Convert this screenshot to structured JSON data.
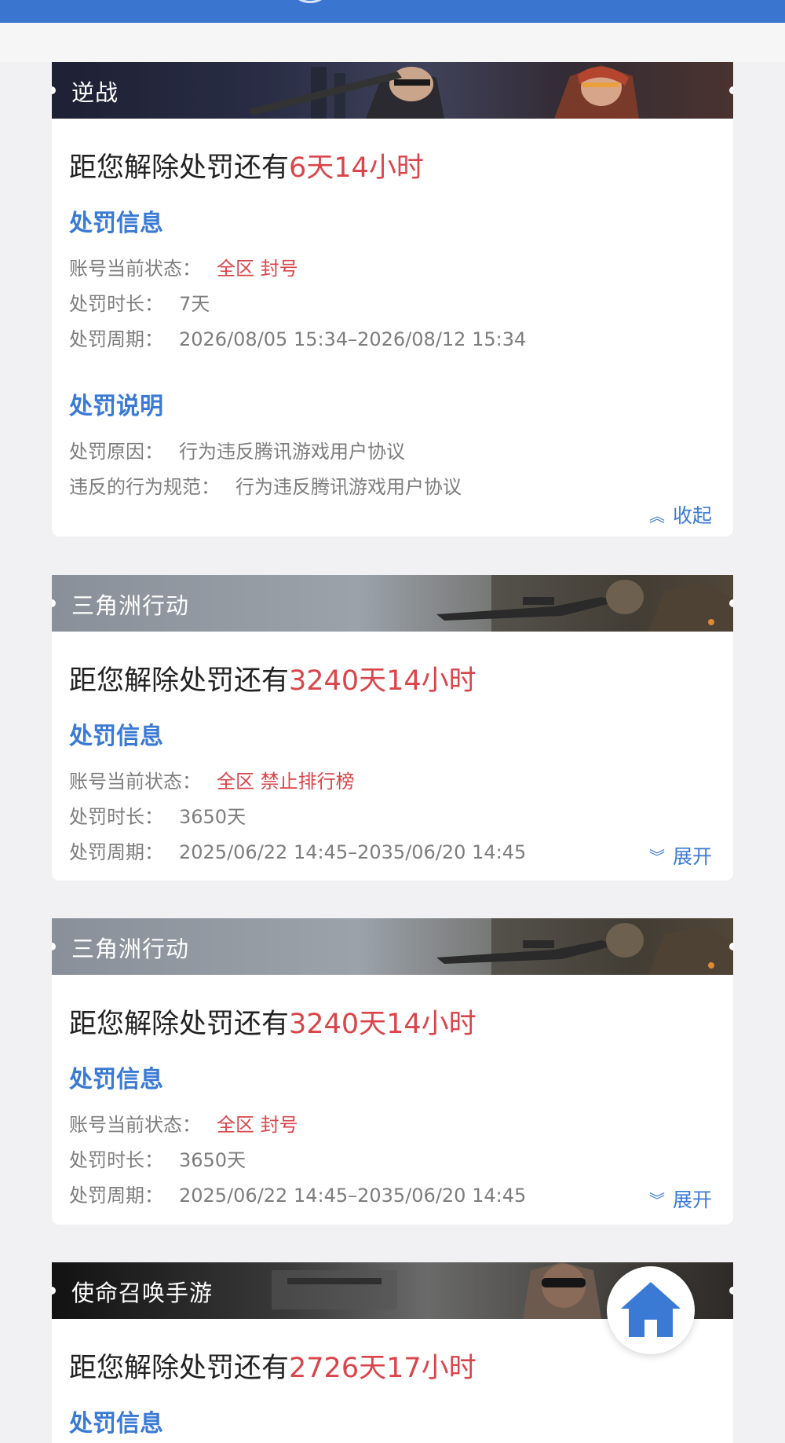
{
  "cards": [
    {
      "game": "逆战",
      "countdown_prefix": "距您解除处罚还有",
      "countdown_value": "6天14小时",
      "info_title": "处罚信息",
      "status_label": "账号当前状态：",
      "status_value": "全区 封号",
      "duration_label": "处罚时长：",
      "duration_value": "7天",
      "period_label": "处罚周期：",
      "period_value": "2026/08/05 15:34–2026/08/12 15:34",
      "desc_title": "处罚说明",
      "reason_label": "处罚原因：",
      "reason_value": "行为违反腾讯游戏用户协议",
      "rule_label": "违反的行为规范：",
      "rule_value": "行为违反腾讯游戏用户协议",
      "toggle_label": "收起",
      "toggle_icon": "double-chevron-up-icon"
    },
    {
      "game": "三角洲行动",
      "countdown_prefix": "距您解除处罚还有",
      "countdown_value": "3240天14小时",
      "info_title": "处罚信息",
      "status_label": "账号当前状态：",
      "status_value": "全区 禁止排行榜",
      "duration_label": "处罚时长：",
      "duration_value": "3650天",
      "period_label": "处罚周期：",
      "period_value": "2025/06/22 14:45–2035/06/20 14:45",
      "toggle_label": "展开",
      "toggle_icon": "double-chevron-down-icon"
    },
    {
      "game": "三角洲行动",
      "countdown_prefix": "距您解除处罚还有",
      "countdown_value": "3240天14小时",
      "info_title": "处罚信息",
      "status_label": "账号当前状态：",
      "status_value": "全区 封号",
      "duration_label": "处罚时长：",
      "duration_value": "3650天",
      "period_label": "处罚周期：",
      "period_value": "2025/06/22 14:45–2035/06/20 14:45",
      "toggle_label": "展开",
      "toggle_icon": "double-chevron-down-icon"
    },
    {
      "game": "使命召唤手游",
      "countdown_prefix": "距您解除处罚还有",
      "countdown_value": "2726天17小时",
      "info_title": "处罚信息"
    }
  ],
  "home_button_icon": "home-icon",
  "colors": {
    "accent_blue": "#3a7ad5",
    "penalty_red": "#d9454a",
    "top_bar": "#3a76d0",
    "page_bg": "#f1f1f3"
  }
}
